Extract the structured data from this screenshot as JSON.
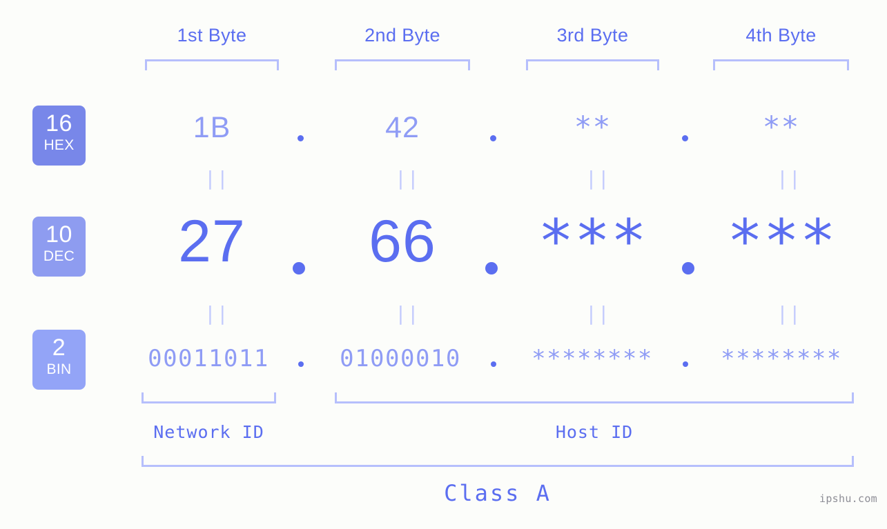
{
  "meta": {
    "background_color": "#fcfdfa",
    "accent_color": "#5b6ef0",
    "light_accent_color": "#8f9cf5",
    "bracket_color": "#b6bffc",
    "watermark": "ipshu.com"
  },
  "byte_headers": [
    {
      "label": "1st Byte"
    },
    {
      "label": "2nd Byte"
    },
    {
      "label": "3rd Byte"
    },
    {
      "label": "4th Byte"
    }
  ],
  "bases": [
    {
      "number": "16",
      "name": "HEX",
      "color": "#7887e9"
    },
    {
      "number": "10",
      "name": "DEC",
      "color": "#8e9cf0"
    },
    {
      "number": "2",
      "name": "BIN",
      "color": "#93a4f7"
    }
  ],
  "rows": {
    "hex": {
      "base_number": "16",
      "base_name": "HEX",
      "values": [
        "1B",
        "42",
        "**",
        "**"
      ],
      "separators": [
        ".",
        ".",
        "."
      ]
    },
    "dec": {
      "base_number": "10",
      "base_name": "DEC",
      "values": [
        "27",
        "66",
        "***",
        "***"
      ],
      "separators": [
        ".",
        ".",
        "."
      ]
    },
    "bin": {
      "base_number": "2",
      "base_name": "BIN",
      "values": [
        "00011011",
        "01000010",
        "********",
        "********"
      ],
      "separators": [
        ".",
        ".",
        "."
      ]
    }
  },
  "equals_glyph": "||",
  "sections": {
    "network_id": "Network ID",
    "host_id": "Host ID",
    "class": "Class A"
  }
}
